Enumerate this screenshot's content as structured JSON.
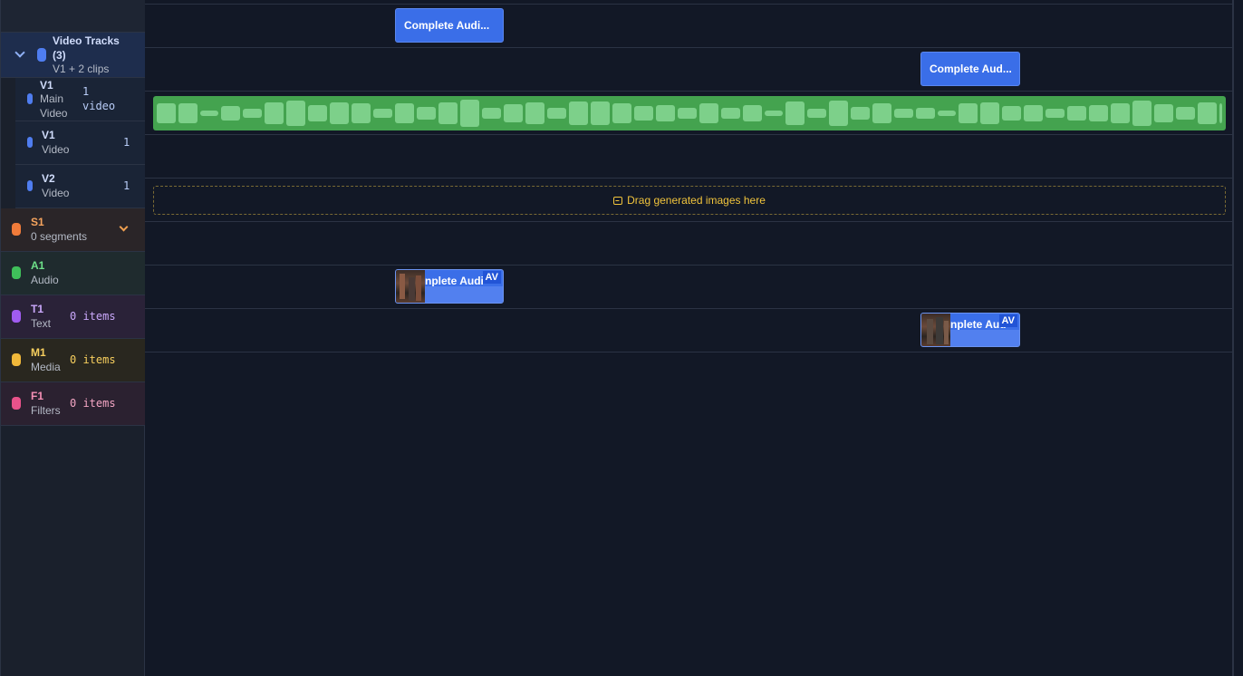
{
  "sidebar": {
    "group": {
      "title": "Video Tracks (3)",
      "subtitle": "V1 + 2 clips"
    },
    "tracks": [
      {
        "id": "V1",
        "type": "Main Video",
        "count": "1 video"
      },
      {
        "id": "V1",
        "type": "Video",
        "count": "1"
      },
      {
        "id": "V2",
        "type": "Video",
        "count": "1"
      },
      {
        "id": "S1",
        "type": "0 segments",
        "count": ""
      },
      {
        "id": "A1",
        "type": "Audio",
        "count": ""
      },
      {
        "id": "T1",
        "type": "Text",
        "count": "0 items"
      },
      {
        "id": "M1",
        "type": "Media",
        "count": "0 items"
      },
      {
        "id": "F1",
        "type": "Filters",
        "count": "0 items"
      }
    ]
  },
  "timeline": {
    "clips": [
      {
        "label": "Complete Audi..."
      },
      {
        "label": "Complete Aud..."
      }
    ],
    "dropzone_text": "Drag generated images here",
    "av_clips": [
      {
        "label": "nplete Audi",
        "badge": "AV"
      },
      {
        "label": "nplete Aud",
        "badge": "AV"
      }
    ]
  },
  "colors": {
    "video": "#4f7df0",
    "subtitle": "#f07b3a",
    "audio": "#3fbf5a",
    "text": "#a05cf0",
    "media": "#f0b83a",
    "filters": "#e8528a"
  }
}
